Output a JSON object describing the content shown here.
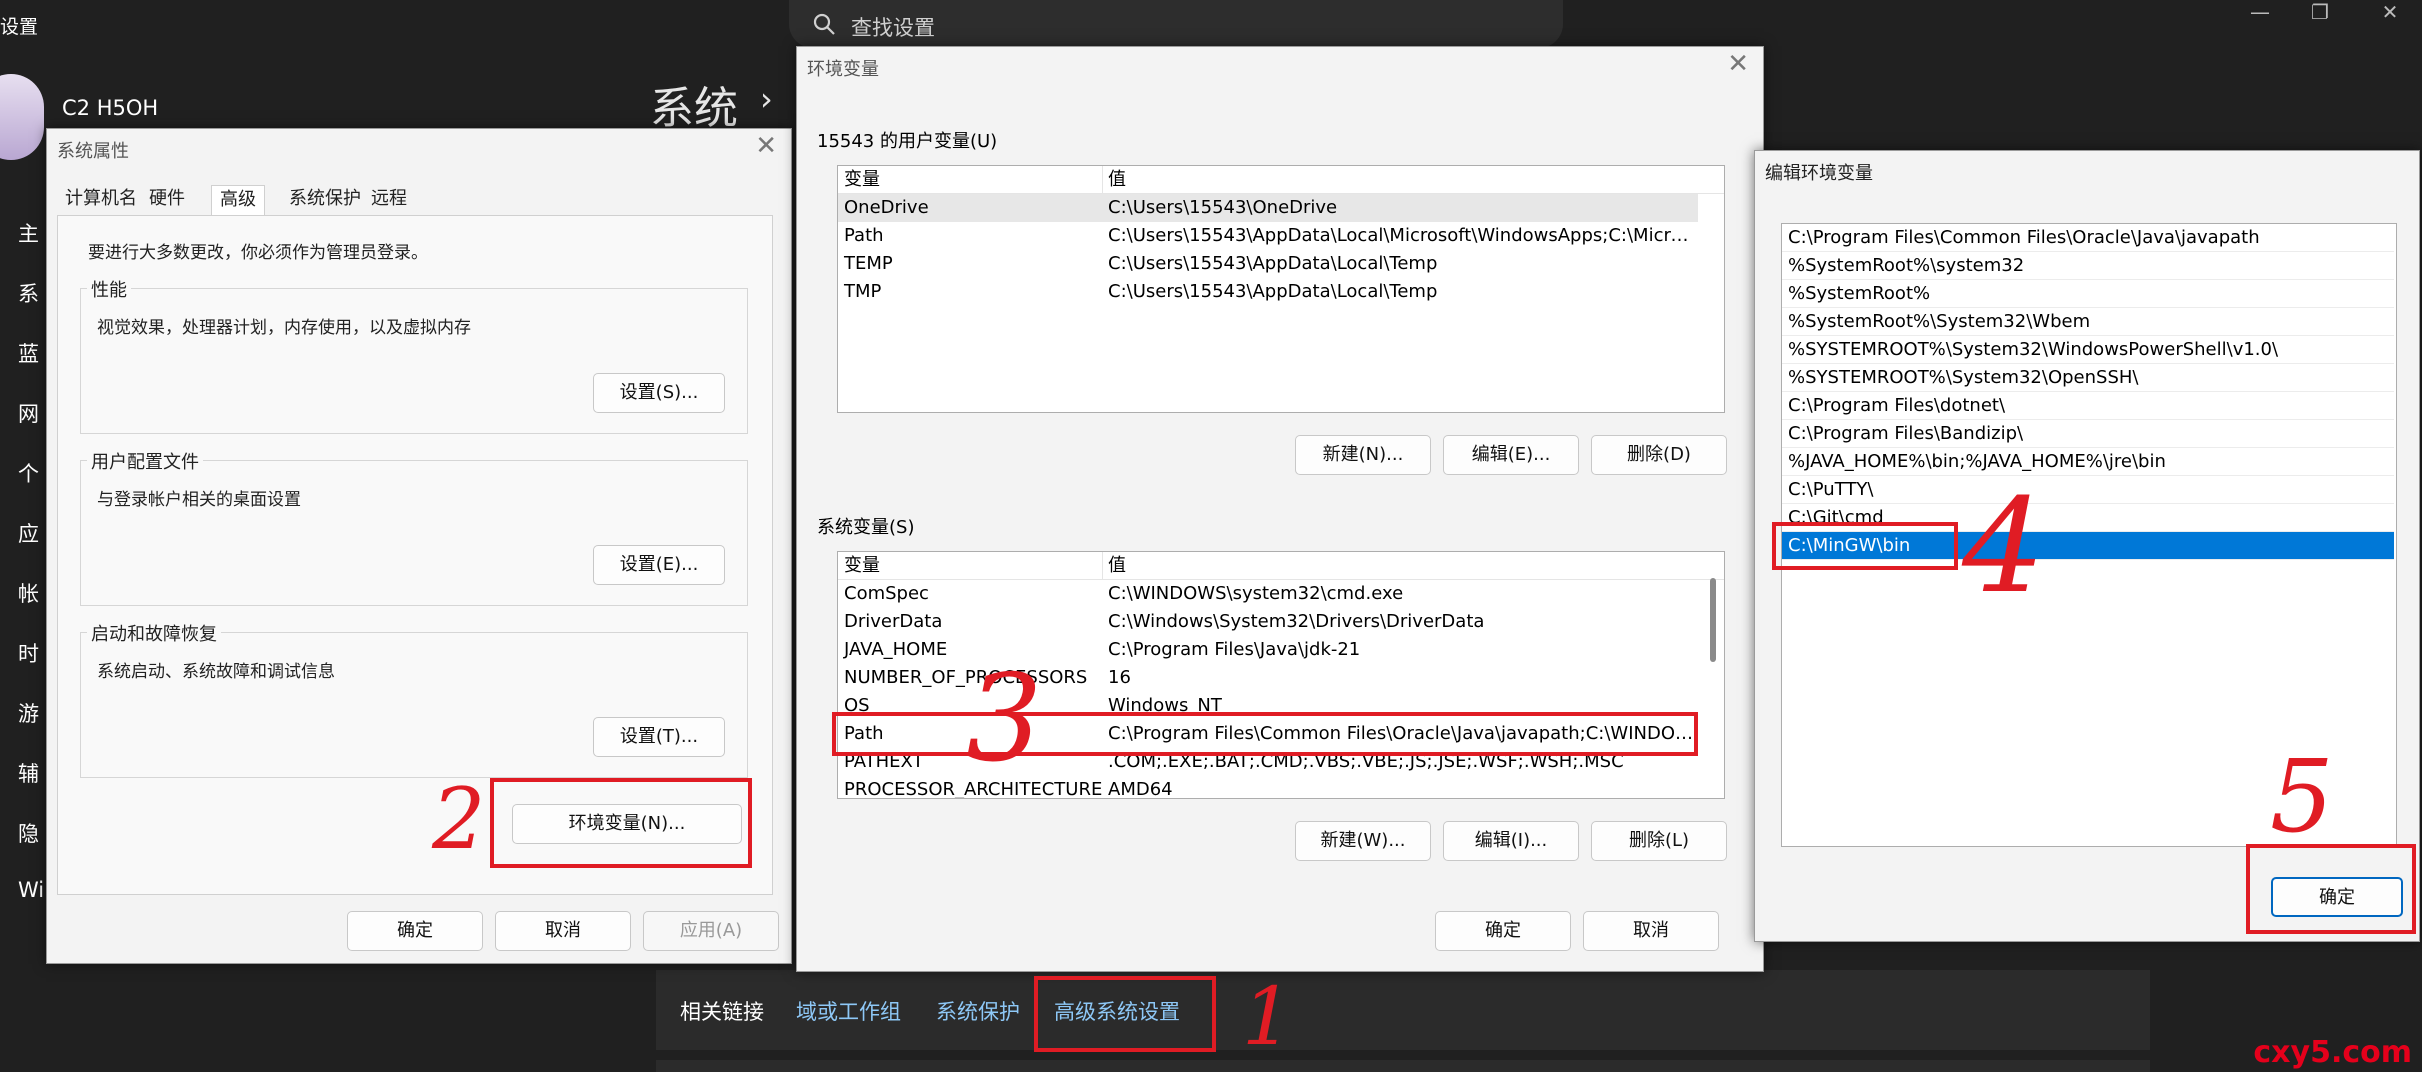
{
  "background": {
    "title": "设置",
    "search_placeholder": "查找设置",
    "window_controls": [
      "—",
      "❐",
      "✕"
    ],
    "user_name": "C2 H5OH",
    "section": "系统",
    "section_chevron": "›",
    "nav_items": [
      "主",
      "系",
      "蓝",
      "网",
      "个",
      "应",
      "帐",
      "时",
      "游",
      "辅",
      "隐",
      "Wi"
    ],
    "related_label": "相关链接",
    "related_links": [
      "域或工作组",
      "系统保护",
      "高级系统设置"
    ]
  },
  "sysprops": {
    "title": "系统属性",
    "close": "✕",
    "tabs": [
      "计算机名",
      "硬件",
      "高级",
      "系统保护",
      "远程"
    ],
    "admin_note": "要进行大多数更改，你必须作为管理员登录。",
    "perf_label": "性能",
    "perf_desc": "视觉效果，处理器计划，内存使用，以及虚拟内存",
    "perf_btn": "设置(S)...",
    "profile_label": "用户配置文件",
    "profile_desc": "与登录帐户相关的桌面设置",
    "profile_btn": "设置(E)...",
    "startup_label": "启动和故障恢复",
    "startup_desc": "系统启动、系统故障和调试信息",
    "startup_btn": "设置(T)...",
    "env_btn": "环境变量(N)...",
    "ok": "确定",
    "cancel": "取消",
    "apply": "应用(A)"
  },
  "envvars": {
    "title": "环境变量",
    "close": "✕",
    "user_label": "15543 的用户变量(U)",
    "col_var": "变量",
    "col_val": "值",
    "user_rows": [
      {
        "name": "OneDrive",
        "value": "C:\\Users\\15543\\OneDrive"
      },
      {
        "name": "Path",
        "value": "C:\\Users\\15543\\AppData\\Local\\Microsoft\\WindowsApps;C:\\Micro..."
      },
      {
        "name": "TEMP",
        "value": "C:\\Users\\15543\\AppData\\Local\\Temp"
      },
      {
        "name": "TMP",
        "value": "C:\\Users\\15543\\AppData\\Local\\Temp"
      }
    ],
    "user_new": "新建(N)...",
    "user_edit": "编辑(E)...",
    "user_delete": "删除(D)",
    "sys_label": "系统变量(S)",
    "sys_rows": [
      {
        "name": "ComSpec",
        "value": "C:\\WINDOWS\\system32\\cmd.exe"
      },
      {
        "name": "DriverData",
        "value": "C:\\Windows\\System32\\Drivers\\DriverData"
      },
      {
        "name": "JAVA_HOME",
        "value": "C:\\Program Files\\Java\\jdk-21"
      },
      {
        "name": "NUMBER_OF_PROCESSORS",
        "value": "16"
      },
      {
        "name": "OS",
        "value": "Windows_NT"
      },
      {
        "name": "Path",
        "value": "C:\\Program Files\\Common Files\\Oracle\\Java\\javapath;C:\\WINDOW..."
      },
      {
        "name": "PATHEXT",
        "value": ".COM;.EXE;.BAT;.CMD;.VBS;.VBE;.JS;.JSE;.WSF;.WSH;.MSC"
      },
      {
        "name": "PROCESSOR_ARCHITECTURE",
        "value": "AMD64"
      }
    ],
    "sys_new": "新建(W)...",
    "sys_edit": "编辑(I)...",
    "sys_delete": "删除(L)",
    "ok": "确定",
    "cancel": "取消"
  },
  "editenv": {
    "title": "编辑环境变量",
    "entries": [
      "C:\\Program Files\\Common Files\\Oracle\\Java\\javapath",
      "%SystemRoot%\\system32",
      "%SystemRoot%",
      "%SystemRoot%\\System32\\Wbem",
      "%SYSTEMROOT%\\System32\\WindowsPowerShell\\v1.0\\",
      "%SYSTEMROOT%\\System32\\OpenSSH\\",
      "C:\\Program Files\\dotnet\\",
      "C:\\Program Files\\Bandizip\\",
      "%JAVA_HOME%\\bin;%JAVA_HOME%\\jre\\bin",
      "C:\\PuTTY\\",
      "C:\\Git\\cmd",
      "C:\\MinGW\\bin"
    ],
    "selected_index": 11,
    "ok": "确定"
  },
  "annotations": {
    "step1": "1",
    "step2": "2",
    "step3": "3",
    "step4": "4",
    "step5": "5",
    "color": "#e01c24"
  },
  "watermark": "cxy5.com"
}
